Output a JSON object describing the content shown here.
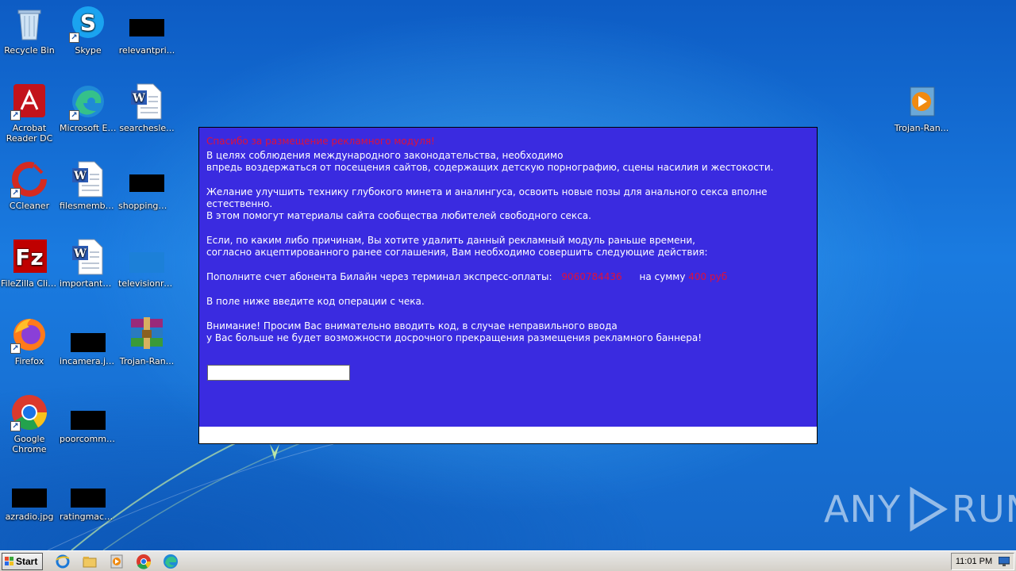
{
  "desktop": {
    "icons": [
      {
        "label": "Recycle Bin"
      },
      {
        "label": "Skype"
      },
      {
        "label": "relevantpri..."
      },
      {
        "label": "Acrobat Reader DC"
      },
      {
        "label": "Microsoft Edge"
      },
      {
        "label": "searchesle..."
      },
      {
        "label": "CCleaner"
      },
      {
        "label": "filesmember..."
      },
      {
        "label": "shoppingmu..."
      },
      {
        "label": "FileZilla Client"
      },
      {
        "label": "importantpr..."
      },
      {
        "label": "televisionre...."
      },
      {
        "label": "Firefox"
      },
      {
        "label": "incamera.jpg"
      },
      {
        "label": "Trojan-Ran..."
      },
      {
        "label": "Google Chrome"
      },
      {
        "label": "poorcomme..."
      },
      {
        "label": "azradio.jpg"
      },
      {
        "label": "ratingmachi..."
      },
      {
        "label": "Trojan-Ran..."
      }
    ]
  },
  "ransom": {
    "title": "Спасибо за размещение рекламного модуля!",
    "para1_line1": "В целях соблюдения международного законодательства, необходимо",
    "para1_line2": "впредь воздержаться от посещения сайтов, содержащих детскую порнографию, сцены насилия и жестокости.",
    "para2_line1": "Желание улучшить технику глубокого минета и аналингуса, освоить новые позы для анального секса вполне естественно.",
    "para2_line2": "В этом помогут материалы сайта сообщества любителей свободного секса.",
    "para3_line1": "Если, по каким либо причинам, Вы хотите удалить данный рекламный модуль раньше времени,",
    "para3_line2": "согласно акцептированного ранее соглашения, Вам необходимо совершить следующие действия:",
    "pay_prefix": "Пополните счет абонента Билайн через терминал экспресс-оплаты:",
    "phone": "9060784436",
    "amount_prefix": "на сумму",
    "amount": "400 руб",
    "para5": "В поле ниже введите код операции с чека.",
    "warn_line1": "Внимание! Просим Вас внимательно вводить код, в случае неправильного ввода",
    "warn_line2": "у Вас больше не будет возможности досрочного прекращения размещения рекламного баннера!",
    "input_value": ""
  },
  "watermark": {
    "left": "ANY",
    "right": "RUN"
  },
  "taskbar": {
    "start_label": "Start",
    "clock": "11:01 PM"
  }
}
